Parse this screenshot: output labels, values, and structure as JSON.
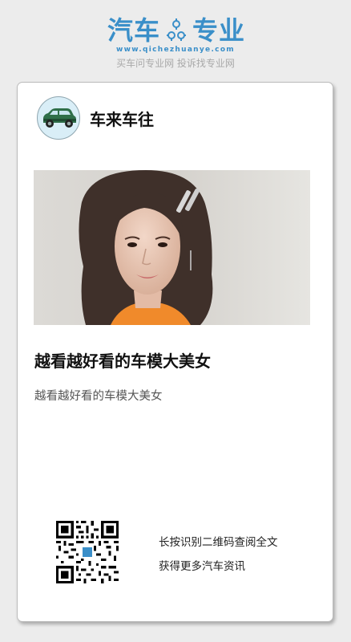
{
  "header": {
    "logo_left": "汽车",
    "logo_right": "专业",
    "domain": "www.qichezhuanye.com",
    "slogan": "买车问专业网 投诉找专业网",
    "brand_color": "#3a8fc9"
  },
  "card": {
    "author": {
      "name": "车来车往",
      "avatar_icon": "car-avatar-icon"
    },
    "hero_image": "car-model-photo",
    "title": "越看越好看的车模大美女",
    "summary": "越看越好看的车模大美女",
    "qr": {
      "icon": "qr-code-icon",
      "hint_1": "长按识别二维码查阅全文",
      "hint_2": "获得更多汽车资讯"
    }
  }
}
